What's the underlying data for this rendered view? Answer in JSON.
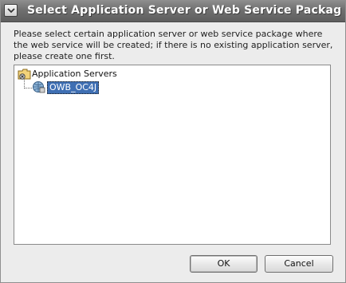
{
  "window": {
    "title": "Select Application Server or Web Service Packag",
    "menu_icon": "chevron-down-icon"
  },
  "instructions": "Please select certain application server or web service package where the web service will be created; if there is no existing application server, please create one first.",
  "tree": {
    "root": {
      "label": "Application Servers",
      "icon": "server-folder-icon"
    },
    "children": [
      {
        "label": "OWB_OC4J",
        "icon": "app-server-icon",
        "selected": true
      }
    ]
  },
  "buttons": {
    "ok": "OK",
    "cancel": "Cancel"
  },
  "colors": {
    "titlebar": "#6f6f6f",
    "selection": "#3f6fb3"
  }
}
